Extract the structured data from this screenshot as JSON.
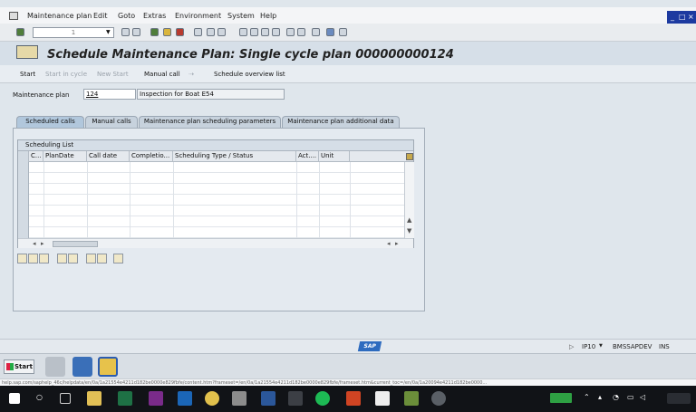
{
  "menu": [
    "Maintenance plan",
    "Edit",
    "Goto",
    "Extras",
    "Environment",
    "System",
    "Help"
  ],
  "command_field": {
    "value": "1"
  },
  "title": "Schedule Maintenance Plan: Single cycle plan 000000000124",
  "app_toolbar": {
    "start": "Start",
    "start_in_cycle": "Start in cycle",
    "new_start": "New Start",
    "manual_call": "Manual call",
    "schedule_overview": "Schedule overview list"
  },
  "plan": {
    "label": "Maintenance plan",
    "number": "124",
    "description": "Inspection for Boat E54"
  },
  "tabs": [
    "Scheduled calls",
    "Manual calls",
    "Maintenance plan scheduling parameters",
    "Maintenance plan additional data"
  ],
  "scheduling_list": {
    "title": "Scheduling List",
    "columns": [
      "C...",
      "PlanDate",
      "Call date",
      "Completio...",
      "Scheduling Type / Status",
      "Act....",
      "Unit"
    ]
  },
  "status": {
    "system": "IP10",
    "server": "BMSSAPDEV",
    "mode": "INS"
  },
  "sap_logo": "SAP",
  "start_button": "Start",
  "url_text": "help.sap.com/saphelp_46c/helpdata/en/0a/1a21554e4211d182be0000e829fbfe/content.htm?frameset=/en/0a/1a21554e4211d182be0000e829fbfe/frameset.htm&current_toc=/en/0a/1a20094e4211d182be0000..."
}
